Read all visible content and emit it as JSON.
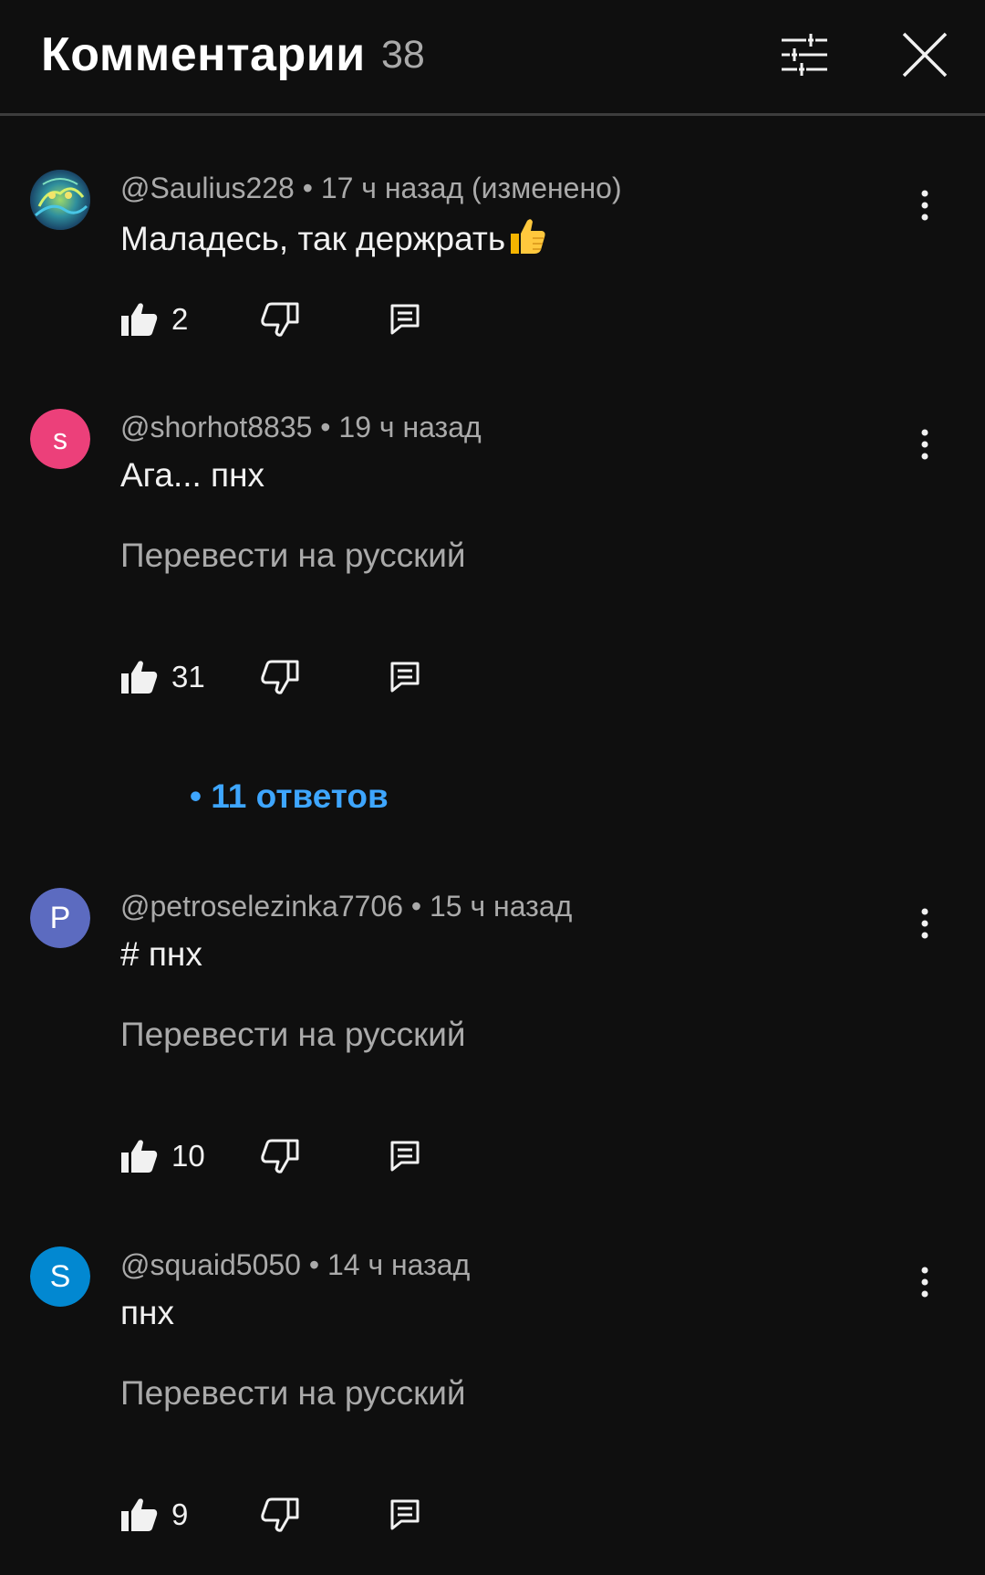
{
  "header": {
    "title": "Комментарии",
    "count": "38"
  },
  "colors": {
    "background": "#0f0f0f",
    "link": "#3ea6ff",
    "secondary_text": "#aaaaaa"
  },
  "comments": [
    {
      "author": "@Saulius228",
      "time": "17 ч назад (изменено)",
      "text": "Маладесь, так держрать",
      "emoji": "thumbs-up-emoji",
      "avatar_type": "image",
      "likes": "2"
    },
    {
      "author": "@shorhot8835",
      "time": "19 ч назад",
      "text": "Ага... пнх",
      "translate": "Перевести на русский",
      "avatar_letter": "s",
      "avatar_color": "#ec407a",
      "likes": "31",
      "replies": "11 ответов"
    },
    {
      "author": "@petroselezinka7706",
      "time": "15 ч назад",
      "text": "# пнх",
      "translate": "Перевести на русский",
      "avatar_letter": "P",
      "avatar_color": "#5c6bc0",
      "likes": "10"
    },
    {
      "author": "@squaid5050",
      "time": "14 ч назад",
      "text": "пнх",
      "translate": "Перевести на русский",
      "avatar_letter": "S",
      "avatar_color": "#0288d1",
      "likes": "9"
    }
  ],
  "separator": "•"
}
